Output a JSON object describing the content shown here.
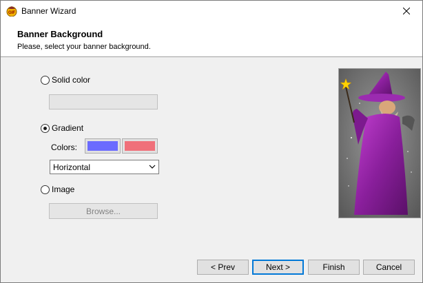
{
  "window": {
    "title": "Banner Wizard"
  },
  "header": {
    "title": "Banner Background",
    "subtitle": "Please, select your banner background."
  },
  "options": {
    "solid_color": {
      "label": "Solid color",
      "checked": false
    },
    "gradient": {
      "label": "Gradient",
      "checked": true,
      "colors_label": "Colors:",
      "color1": "#6b6bff",
      "color2": "#f0707a",
      "direction": "Horizontal"
    },
    "image": {
      "label": "Image",
      "checked": false,
      "browse_label": "Browse..."
    }
  },
  "footer": {
    "prev": "< Prev",
    "next": "Next >",
    "finish": "Finish",
    "cancel": "Cancel"
  },
  "preview": {
    "icon": "wizard-image"
  }
}
